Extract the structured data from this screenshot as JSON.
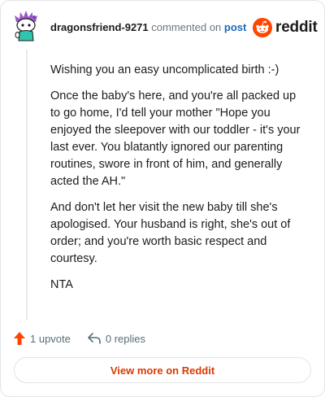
{
  "header": {
    "username": "dragonsfriend-9271",
    "commented_text": "commented on",
    "post_link": "post",
    "brand": "reddit"
  },
  "comment": {
    "paragraphs": [
      "Wishing you an easy uncomplicated birth :-)",
      "Once the baby's here, and you're all packed up to go home, I'd tell your mother \"Hope you enjoyed the sleepover with our toddler - it's your last ever. You blatantly ignored our parenting routines, swore in front of him, and generally acted the AH.\"",
      "And don't let her visit the new baby till she's apologised. Your husband is right, she's out of order; and you're worth basic respect and courtesy.",
      "NTA"
    ]
  },
  "actions": {
    "upvotes": "1 upvote",
    "replies": "0 replies"
  },
  "footer": {
    "view_more": "View more on Reddit"
  },
  "icons": {
    "avatar": "snoo-avatar-icon",
    "brand_logo": "reddit-snoo-icon",
    "upvote": "upvote-arrow-icon",
    "reply": "reply-arrow-icon"
  },
  "colors": {
    "brand_orange": "#ff4500",
    "link_blue": "#1a68b8",
    "view_more_text": "#d93900",
    "muted_text": "#576f76"
  }
}
